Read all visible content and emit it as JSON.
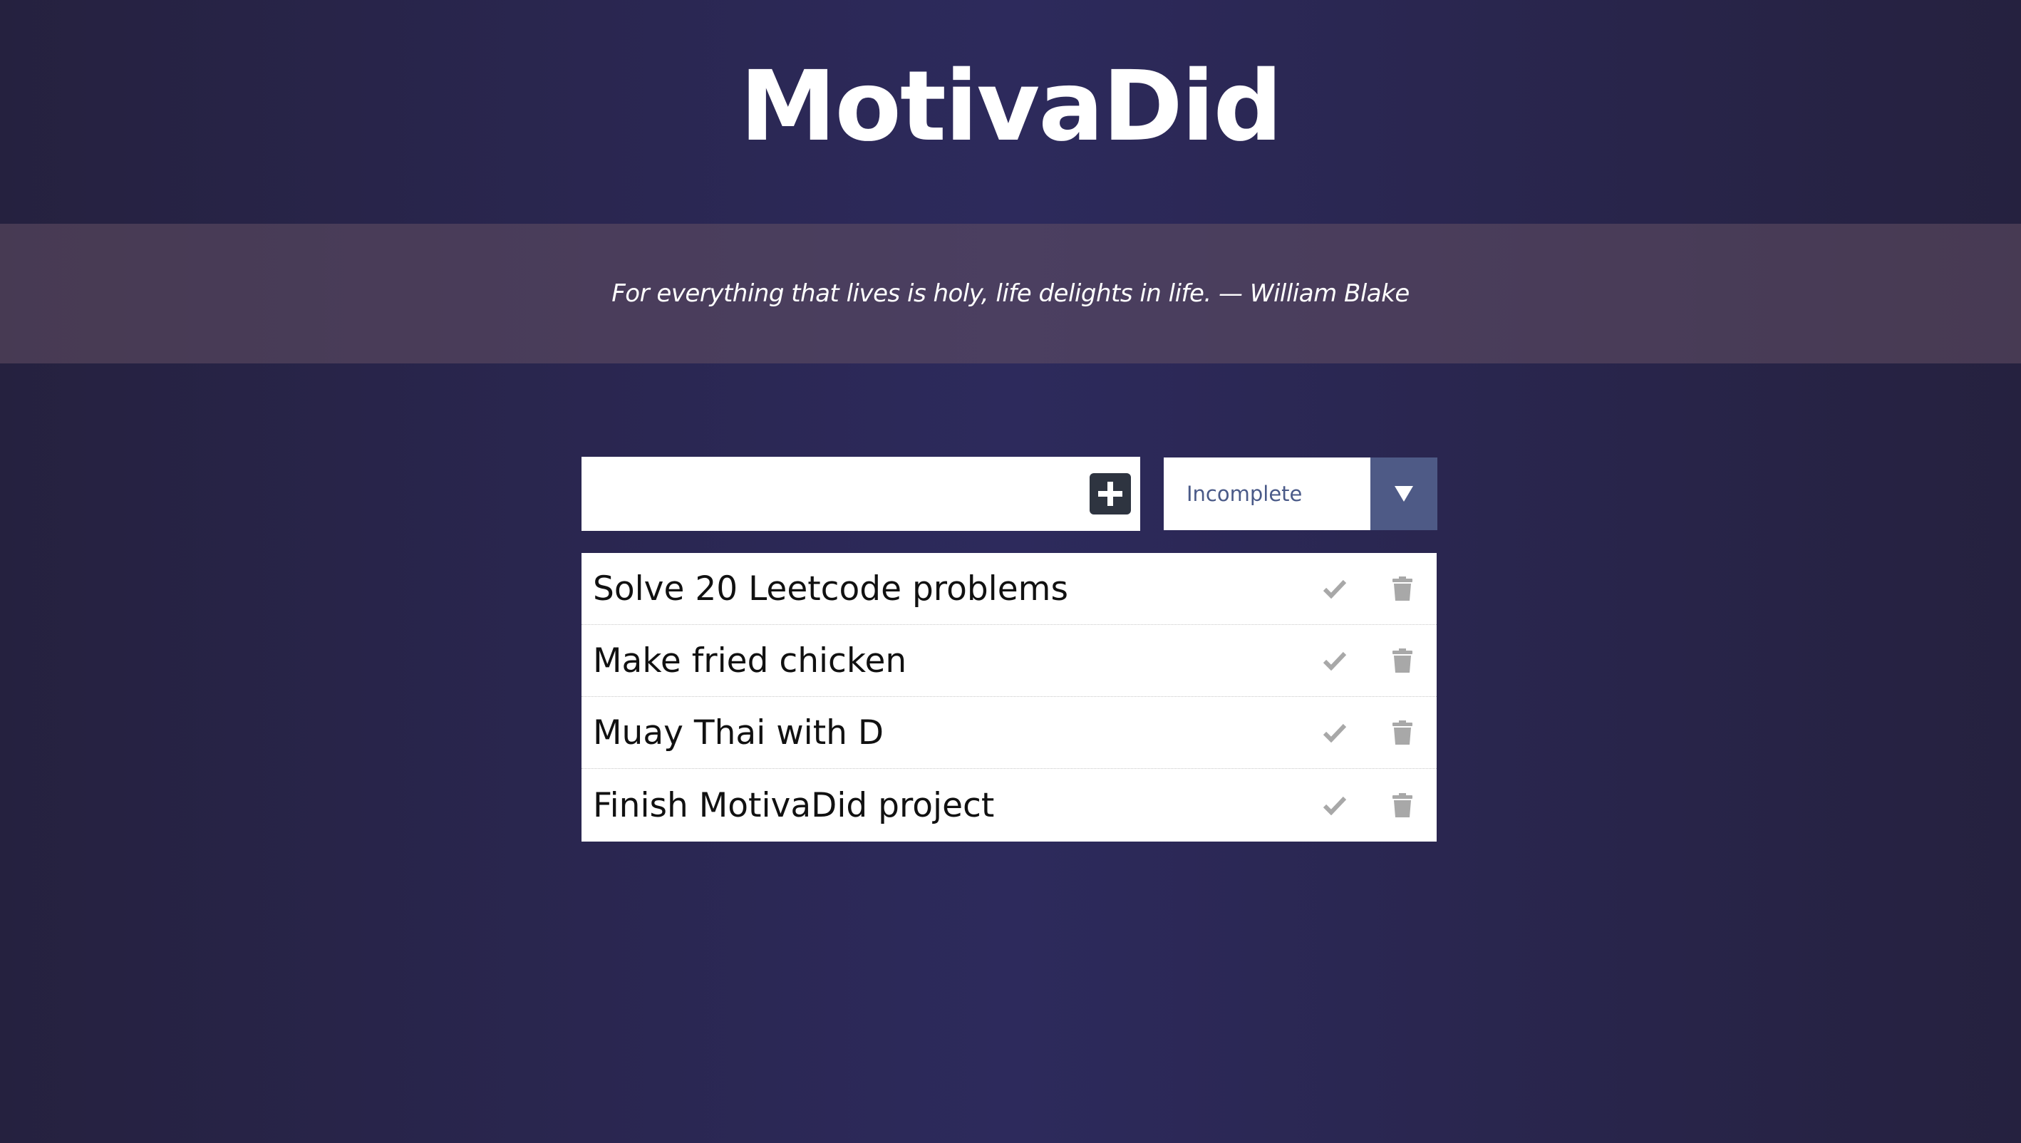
{
  "app": {
    "title": "MotivaDid"
  },
  "quote": {
    "text": "For everything that lives is holy, life delights in life. — William Blake"
  },
  "input": {
    "value": "",
    "placeholder": ""
  },
  "filter": {
    "selected": "Incomplete"
  },
  "todos": [
    {
      "text": "Solve 20 Leetcode problems"
    },
    {
      "text": "Make fried chicken"
    },
    {
      "text": "Muay Thai with D"
    },
    {
      "text": "Finish MotivaDid project"
    }
  ],
  "colors": {
    "background": "#2d2a5c",
    "quote_band": "#4a3e5e",
    "filter_arrow_bg": "#4e5a86",
    "add_button_bg": "#2e3440",
    "action_icon": "#a8a8a8"
  },
  "icons": {
    "add": "plus-square-icon",
    "filter_arrow": "triangle-down-icon",
    "complete": "check-icon",
    "delete": "trash-icon"
  }
}
